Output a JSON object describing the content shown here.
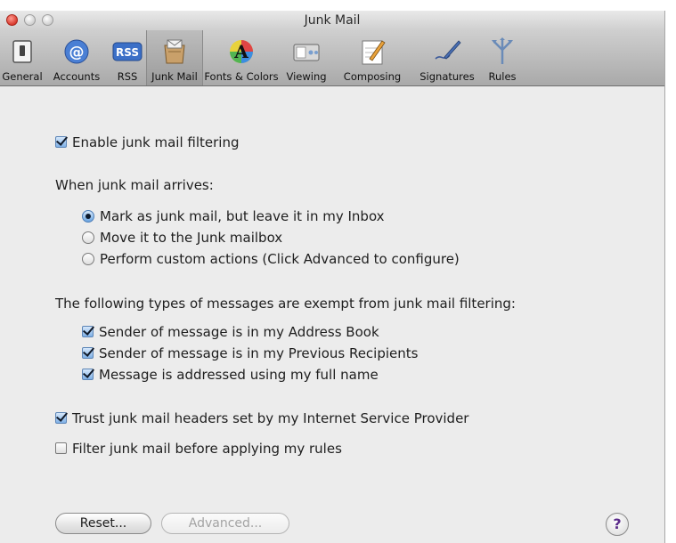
{
  "window": {
    "title": "Junk Mail"
  },
  "toolbar": {
    "items": [
      {
        "label": "General",
        "icon": "general-switch-icon"
      },
      {
        "label": "Accounts",
        "icon": "at-sign-icon"
      },
      {
        "label": "RSS",
        "icon": "rss-badge-icon"
      },
      {
        "label": "Junk Mail",
        "icon": "junk-mail-bin-icon",
        "selected": true
      },
      {
        "label": "Fonts & Colors",
        "icon": "fonts-colors-icon"
      },
      {
        "label": "Viewing",
        "icon": "viewing-icon"
      },
      {
        "label": "Composing",
        "icon": "composing-pencil-icon"
      },
      {
        "label": "Signatures",
        "icon": "signature-pen-icon"
      },
      {
        "label": "Rules",
        "icon": "rules-arrows-icon"
      }
    ],
    "rss_badge_text": "RSS",
    "fonts_icon_text": "A"
  },
  "settings": {
    "enable_filtering": {
      "label": "Enable junk mail filtering",
      "checked": true
    },
    "arrival_heading": "When junk mail arrives:",
    "arrival_options": [
      {
        "label": "Mark as junk mail, but leave it in my Inbox",
        "selected": true
      },
      {
        "label": "Move it to the Junk mailbox",
        "selected": false
      },
      {
        "label": "Perform custom actions (Click Advanced to configure)",
        "selected": false
      }
    ],
    "exempt_heading": "The following types of messages are exempt from junk mail filtering:",
    "exempt_options": [
      {
        "label": "Sender of message is in my Address Book",
        "checked": true
      },
      {
        "label": "Sender of message is in my Previous Recipients",
        "checked": true
      },
      {
        "label": "Message is addressed using my full name",
        "checked": true
      }
    ],
    "trust_headers": {
      "label": "Trust junk mail headers set by my Internet Service Provider",
      "checked": true
    },
    "filter_before_rules": {
      "label": "Filter junk mail before applying my rules",
      "checked": false
    }
  },
  "buttons": {
    "reset": "Reset...",
    "advanced": "Advanced...",
    "advanced_enabled": false,
    "help": "?"
  },
  "colors": {
    "accent_check": "#7fb1e6",
    "help_glyph": "#5a2b8a"
  }
}
